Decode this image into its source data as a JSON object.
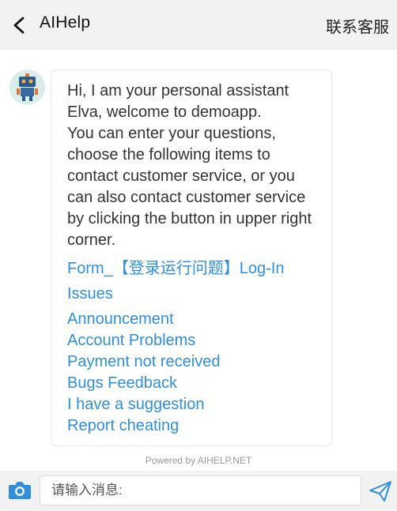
{
  "header": {
    "title": "AIHelp",
    "contact_label": "联系客服",
    "back_icon": "chevron-left-icon"
  },
  "chat": {
    "bot_avatar": "robot-avatar",
    "message": "Hi, I am your personal assistant Elva, welcome to demoapp.\nYou can enter your questions, choose the following items to contact customer service, or you can also contact customer service by clicking the button in upper right corner.",
    "links": [
      "Form_【登录运行问题】Log-In",
      "Issues",
      "Announcement",
      "Account Problems",
      "Payment not received",
      "Bugs Feedback",
      "I have a suggestion",
      "Report cheating"
    ]
  },
  "powered_by": "Powered by AIHELP.NET",
  "composer": {
    "placeholder": "请输入消息:",
    "camera_icon": "camera-icon",
    "send_icon": "send-icon"
  },
  "colors": {
    "link": "#2f8fdc",
    "bar_background": "#f2f2f2",
    "icon_accent": "#2f8fdc"
  }
}
